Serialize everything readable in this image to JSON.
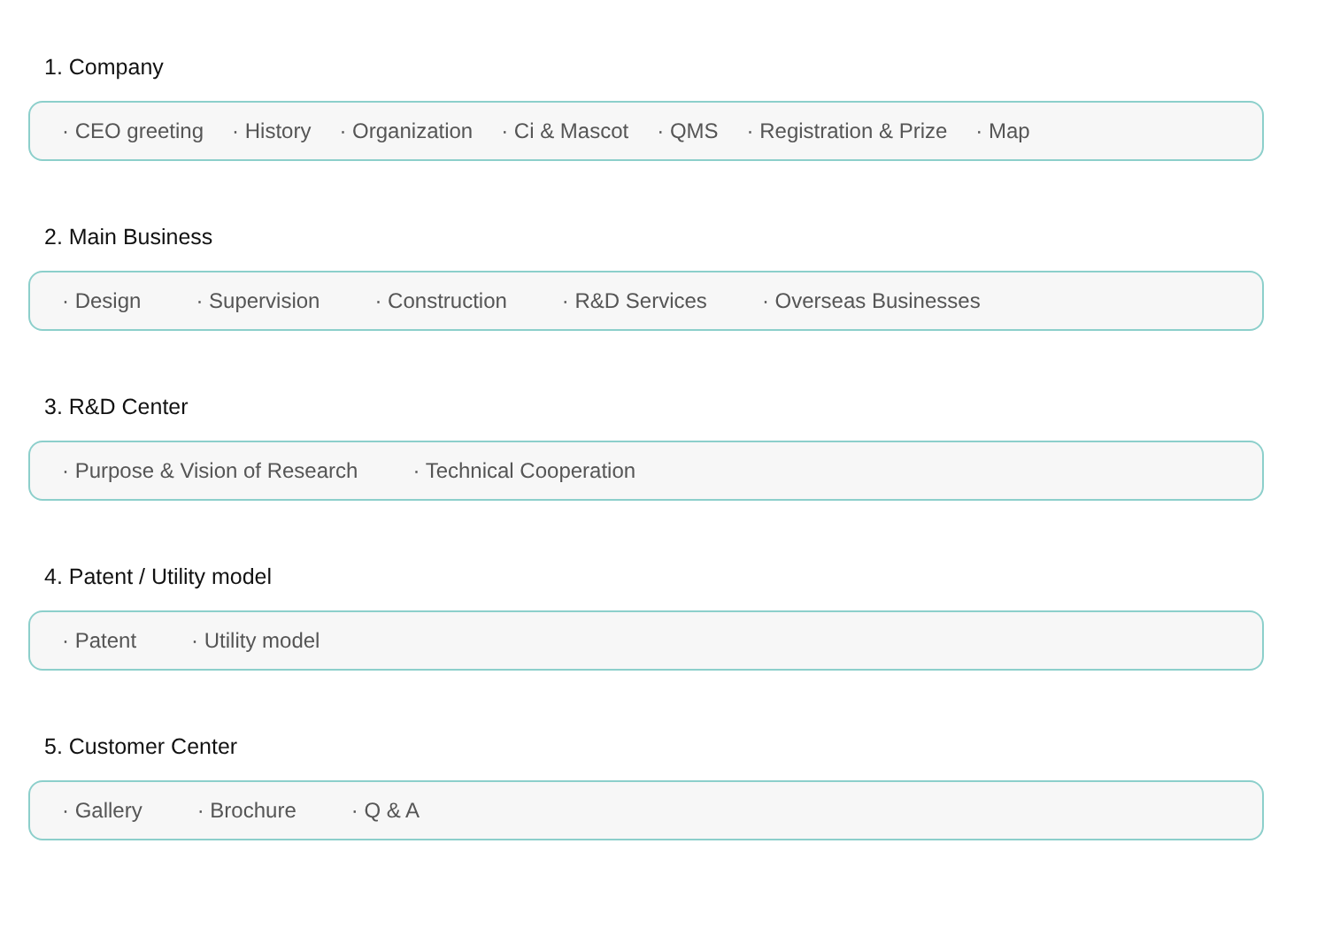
{
  "sections": [
    {
      "title": "1. Company",
      "links": [
        "· CEO greeting",
        "· History",
        "· Organization",
        "· Ci & Mascot",
        "· QMS",
        "· Registration & Prize",
        "· Map"
      ]
    },
    {
      "title": "2. Main Business",
      "links": [
        "· Design",
        "· Supervision",
        "· Construction",
        "· R&D Services",
        "· Overseas Businesses"
      ]
    },
    {
      "title": "3. R&D Center",
      "links": [
        "· Purpose & Vision of Research",
        "· Technical Cooperation"
      ]
    },
    {
      "title": "4. Patent / Utility model",
      "links": [
        "· Patent",
        "· Utility model"
      ]
    },
    {
      "title": "5. Customer Center",
      "links": [
        "· Gallery",
        "· Brochure",
        "· Q & A"
      ]
    }
  ]
}
